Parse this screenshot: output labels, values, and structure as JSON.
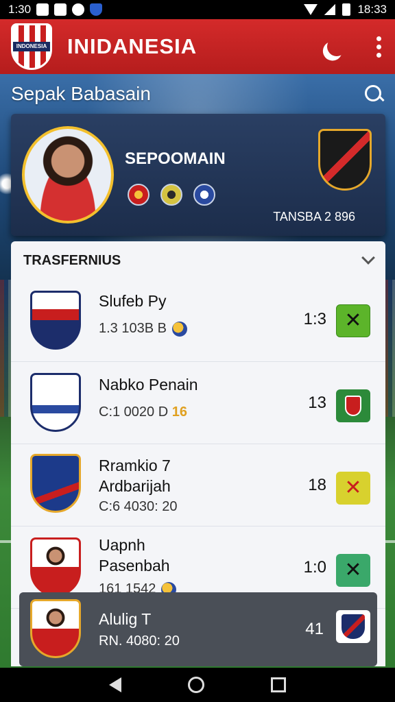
{
  "status_bar": {
    "time_left": "1:30",
    "time_right": "18:33"
  },
  "app_bar": {
    "title": "INIDANESIA",
    "logo_text": "INDONESIA"
  },
  "section": {
    "title": "Sepak Babasain"
  },
  "player": {
    "name": "SEPOOMAIN",
    "transfer_stat": "TANSBA 2 896"
  },
  "transfers": {
    "title": "TRASFERNIUS",
    "rows": [
      {
        "name": "Slufeb Py",
        "meta": "1.3  103B B",
        "score": "1:3",
        "action_color": "#5cb42a"
      },
      {
        "name": "Nabko Penain",
        "meta": "C:1 0020 D",
        "meta_highlight": "16",
        "score": "13",
        "action_color": "#2c8a3a"
      },
      {
        "name_line1": "Rramkio 7",
        "name_line2": "Ardbarijah",
        "meta": "C:6 4030: 20",
        "score": "18",
        "action_color": "#d8d12e"
      },
      {
        "name_line1": "Uapnh",
        "name_line2": "Pasenbah",
        "meta": "161  1542",
        "score": "1:0",
        "action_color": "#3aa86a"
      },
      {
        "name": "Alulig T",
        "meta": "RN. 4080: 20",
        "score": "41",
        "action_color": "#ffffff"
      }
    ]
  },
  "colors": {
    "primary": "#c8202a",
    "card": "#243859",
    "panel": "#f4f5f8"
  }
}
